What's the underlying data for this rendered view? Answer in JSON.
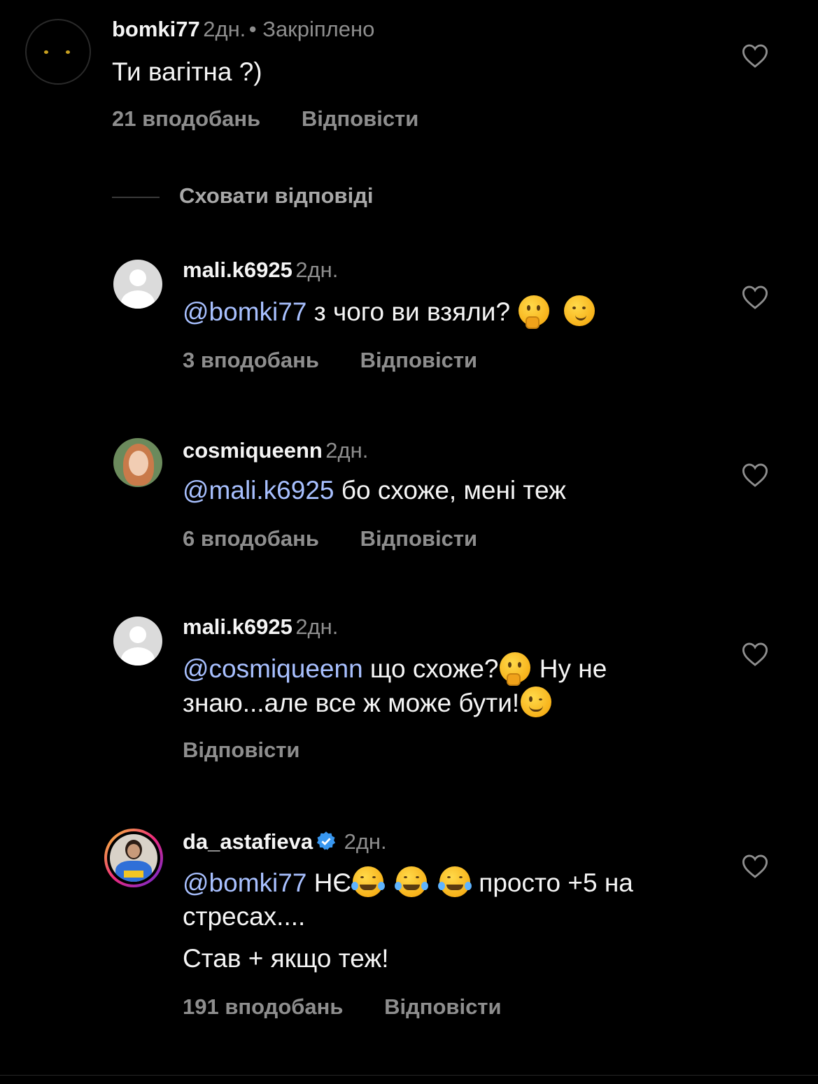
{
  "comments": [
    {
      "username": "bomki77",
      "time": "2дн.",
      "pinned": "Закріплено",
      "text": "Ти вагітна ?)",
      "likes": "21 вподобань",
      "reply": "Відповісти"
    }
  ],
  "hide_replies": "Сховати відповіді",
  "replies": [
    {
      "username": "mali.k6925",
      "time": "2дн.",
      "mention": "@bomki77",
      "text": " з чого ви взяли?",
      "likes": "3 вподобань",
      "reply": "Відповісти"
    },
    {
      "username": "cosmiqueenn",
      "time": "2дн.",
      "mention": "@mali.k6925",
      "text": " бо схоже, мені теж",
      "likes": "6 вподобань",
      "reply": "Відповісти"
    },
    {
      "username": "mali.k6925",
      "time": "2дн.",
      "mention": "@cosmiqueenn",
      "text": " що схоже?",
      "text_after_emoji": " Ну не",
      "text_line2": "знаю...але все ж може бути!",
      "reply": "Відповісти"
    },
    {
      "username": "da_astafieva",
      "time": "2дн.",
      "mention": "@bomki77",
      "text": " НЄ",
      "text_after_emoji": " просто +5 на",
      "text_line2": "стресах....",
      "text_line3": "Став + якщо теж!",
      "likes": "191 вподобань",
      "reply": "Відповісти"
    }
  ],
  "icons": {
    "heart": "heart-outline-icon",
    "verified": "verified-badge-icon"
  },
  "colors": {
    "background": "#000000",
    "mention": "#a8c0ff",
    "secondary_text": "#8e8e8e",
    "verified": "#3897f0"
  }
}
